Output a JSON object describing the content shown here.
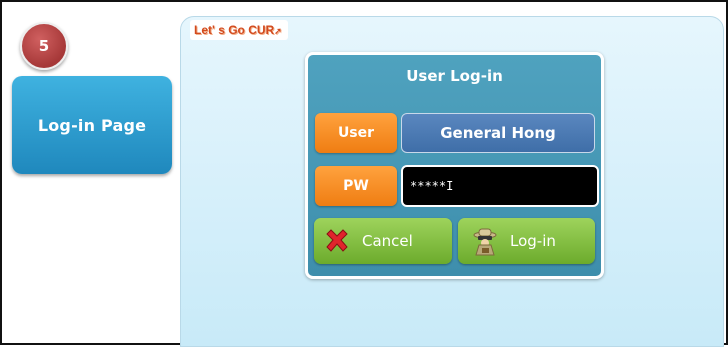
{
  "step": {
    "number": "5"
  },
  "page_label": "Log-in Page",
  "logo": {
    "text": "Let' s Go CUR"
  },
  "dialog": {
    "title": "User Log-in",
    "user_label": "User",
    "user_value": "General Hong",
    "pw_label": "PW",
    "pw_value": "*****I",
    "cancel_label": "Cancel",
    "login_label": "Log-in"
  },
  "icons": {
    "cancel": "red-x-icon",
    "login": "secret-agent-icon"
  },
  "colors": {
    "badge": "#a63838",
    "page_label": "#2a9cd0",
    "dialog": "#4799b7",
    "field_tag": "#f58a1f",
    "user_value": "#4a78b3",
    "button": "#7fbc3a",
    "screen_bg": "#d6f0fb"
  }
}
